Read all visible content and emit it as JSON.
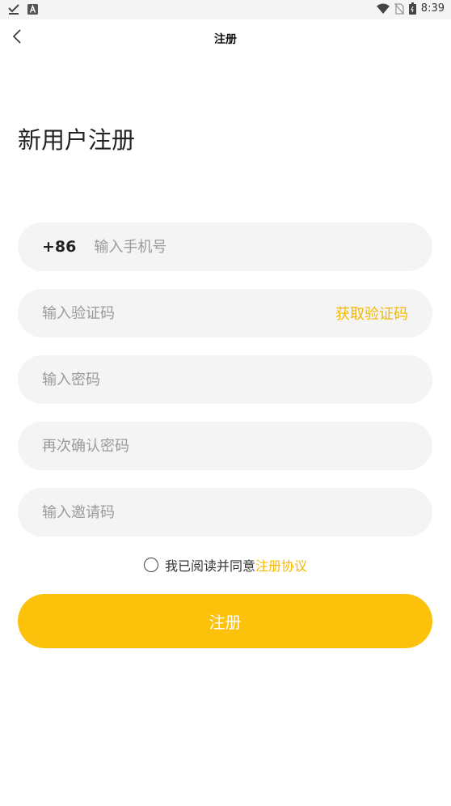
{
  "status_bar": {
    "time": "8:39"
  },
  "app_bar": {
    "title": "注册"
  },
  "heading": "新用户注册",
  "form": {
    "country_code": "+86",
    "phone_placeholder": "输入手机号",
    "code_placeholder": "输入验证码",
    "get_code_label": "获取验证码",
    "password_placeholder": "输入密码",
    "confirm_placeholder": "再次确认密码",
    "invite_placeholder": "输入邀请码"
  },
  "agreement": {
    "text": "我已阅读并同意",
    "link": "注册协议"
  },
  "submit_label": "注册",
  "colors": {
    "accent": "#fcc20b",
    "link": "#f5b800",
    "field_bg": "#f4f4f4"
  },
  "icons": [
    "check-download-icon",
    "a-notification-icon",
    "wifi-icon",
    "no-sim-icon",
    "battery-icon",
    "back-arrow-icon"
  ]
}
